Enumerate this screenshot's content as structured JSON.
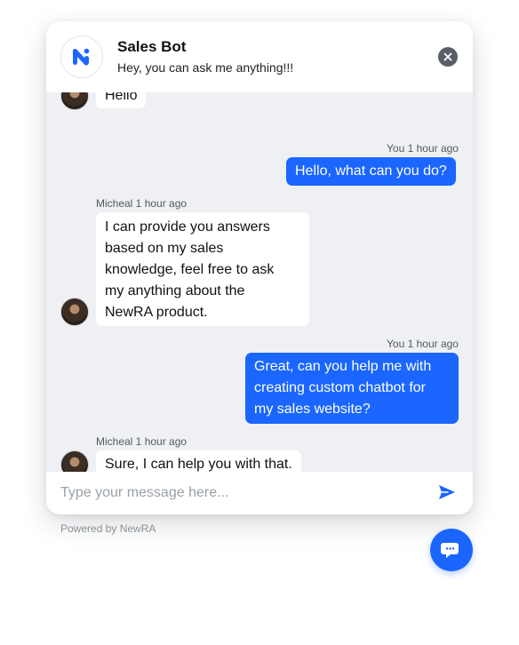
{
  "header": {
    "title": "Sales Bot",
    "subtitle": "Hey, you can ask me anything!!!"
  },
  "messages": [
    {
      "sender": "bot",
      "text": "Hello"
    },
    {
      "sender": "user",
      "meta": "You 1 hour ago",
      "text": "Hello, what can you do?"
    },
    {
      "sender": "bot",
      "meta": "Micheal 1 hour ago",
      "lines": [
        "I can provide you answers",
        "based on my sales",
        "knowledge, feel free to ask",
        "my anything about the",
        "NewRA product."
      ]
    },
    {
      "sender": "user",
      "meta": "You 1 hour ago",
      "lines": [
        "Great, can you help me with",
        "creating custom chatbot for",
        "my sales website?"
      ]
    },
    {
      "sender": "bot",
      "meta": "Micheal 1 hour ago",
      "text": "Sure, I can help you with that."
    }
  ],
  "composer": {
    "placeholder": "Type your message here..."
  },
  "footer": {
    "powered_by": "Powered by NewRA"
  },
  "colors": {
    "accent": "#1a66ff",
    "chat_background": "#eef0f3"
  },
  "icons": {
    "logo": "newra-logo-icon",
    "close": "close-icon",
    "send": "send-icon",
    "launcher": "chat-bubble-icon"
  }
}
